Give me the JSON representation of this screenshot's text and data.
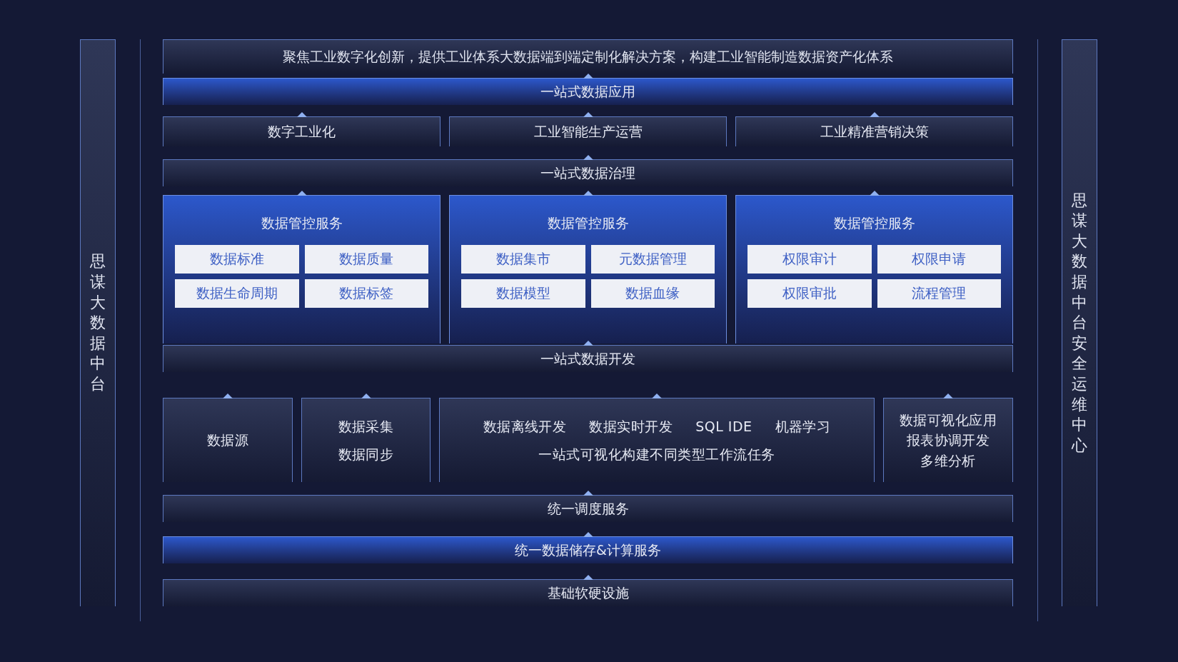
{
  "side_left": "思谋大数据中台",
  "side_right": "思谋大数据中台安全运维中心",
  "layers": [
    {
      "kind": "banner",
      "text": "聚焦工业数字化创新，提供工业体系大数据端到端定制化解决方案，构建工业智能制造数据资产化体系"
    },
    {
      "kind": "blue_bar",
      "text": "一站式数据应用"
    },
    {
      "kind": "boxes",
      "items": [
        "数字工业化",
        "工业智能生产运营",
        "工业精准营销决策"
      ]
    },
    {
      "kind": "bar",
      "text": "一站式数据治理"
    },
    {
      "kind": "services",
      "panels": [
        {
          "title": "数据管控服务",
          "items": [
            "数据标准",
            "数据质量",
            "数据生命周期",
            "数据标签"
          ]
        },
        {
          "title": "数据管控服务",
          "items": [
            "数据集市",
            "元数据管理",
            "数据模型",
            "数据血缘"
          ]
        },
        {
          "title": "数据管控服务",
          "items": [
            "权限审计",
            "权限申请",
            "权限审批",
            "流程管理"
          ]
        }
      ]
    },
    {
      "kind": "bar",
      "text": "一站式数据开发"
    },
    {
      "kind": "modules",
      "items": [
        {
          "lines": [
            [
              "数据源"
            ]
          ]
        },
        {
          "lines": [
            [
              "数据采集"
            ],
            [
              "数据同步"
            ]
          ]
        },
        {
          "lines": [
            [
              "数据离线开发",
              "数据实时开发",
              "SQL IDE",
              "机器学习"
            ],
            [
              "一站式可视化构建不同类型工作流任务"
            ]
          ]
        },
        {
          "lines": [
            [
              "数据可视化应用"
            ],
            [
              "报表协调开发"
            ],
            [
              "多维分析"
            ]
          ]
        }
      ]
    },
    {
      "kind": "bar",
      "text": "统一调度服务"
    },
    {
      "kind": "blue_bar",
      "text": "统一数据储存&计算服务"
    },
    {
      "kind": "bar",
      "text": "基础软硬设施"
    }
  ]
}
